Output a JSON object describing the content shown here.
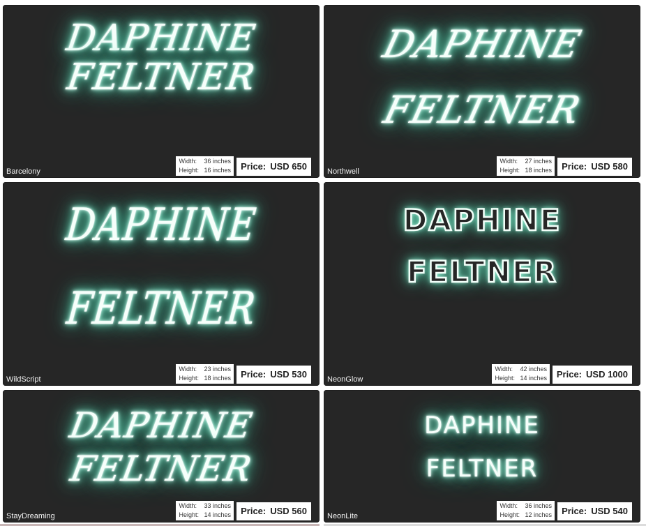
{
  "cards": [
    {
      "name": "Barcelony",
      "line1": "DAPHINE",
      "line2": "FELTNER",
      "width_label": "Width:",
      "width_value": "36 inches",
      "height_label": "Height:",
      "height_value": "16 inches",
      "price_label": "Price:",
      "price_value": "USD 650"
    },
    {
      "name": "Northwell",
      "line1": "DAPHINE",
      "line2": "FELTNER",
      "width_label": "Width:",
      "width_value": "27 inches",
      "height_label": "Height:",
      "height_value": "18 inches",
      "price_label": "Price:",
      "price_value": "USD 580"
    },
    {
      "name": "WildScript",
      "line1": "DAPHINE",
      "line2": "FELTNER",
      "width_label": "Width:",
      "width_value": "23 inches",
      "height_label": "Height:",
      "height_value": "18 inches",
      "price_label": "Price:",
      "price_value": "USD 530"
    },
    {
      "name": "NeonGlow",
      "line1": "DAPHINE",
      "line2": "FELTNER",
      "width_label": "Width:",
      "width_value": "42 inches",
      "height_label": "Height:",
      "height_value": "14 inches",
      "price_label": "Price:",
      "price_value": "USD 1000"
    },
    {
      "name": "StayDreaming",
      "line1": "DAPHINE",
      "line2": "FELTNER",
      "width_label": "Width:",
      "width_value": "33 inches",
      "height_label": "Height:",
      "height_value": "14 inches",
      "price_label": "Price:",
      "price_value": "USD 560"
    },
    {
      "name": "NeonLite",
      "line1": "DAPHINE",
      "line2": "FELTNER",
      "width_label": "Width:",
      "width_value": "36 inches",
      "height_label": "Height:",
      "height_value": "12 inches",
      "price_label": "Price:",
      "price_value": "USD 540"
    }
  ],
  "colors": {
    "card_background": "#262626",
    "neon_core": "#f6fffb",
    "neon_glow": "#4fd7b0"
  }
}
